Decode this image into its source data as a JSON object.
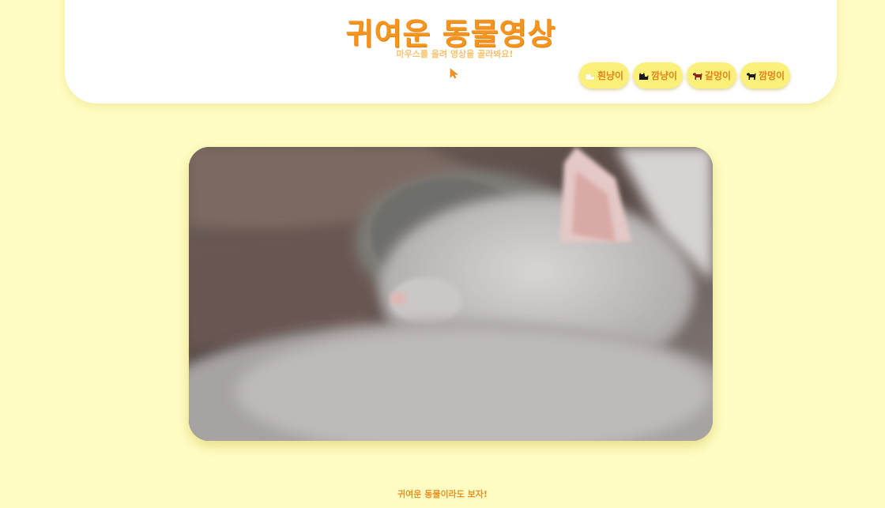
{
  "header": {
    "title": "귀여운 동물영상",
    "subtitle": "마우스를 올려 영상을 골라봐요!"
  },
  "buttons": [
    {
      "label": "흰냥이",
      "icon": "white-cat-icon",
      "icon_color": "#ffffff"
    },
    {
      "label": "깜냥이",
      "icon": "black-cat-icon",
      "icon_color": "#1a1a1a"
    },
    {
      "label": "갈멍이",
      "icon": "brown-dog-icon",
      "icon_color": "#8B1F1F"
    },
    {
      "label": "깜멍이",
      "icon": "black-dog-icon",
      "icon_color": "#1a1a1a"
    }
  ],
  "video": {
    "subject": "sleeping cats video"
  },
  "footer": {
    "text": "귀여운 동물이라도 보자!"
  },
  "colors": {
    "background": "#FFFDC4",
    "accent": "#F5941E",
    "button": "#FBF07A"
  }
}
